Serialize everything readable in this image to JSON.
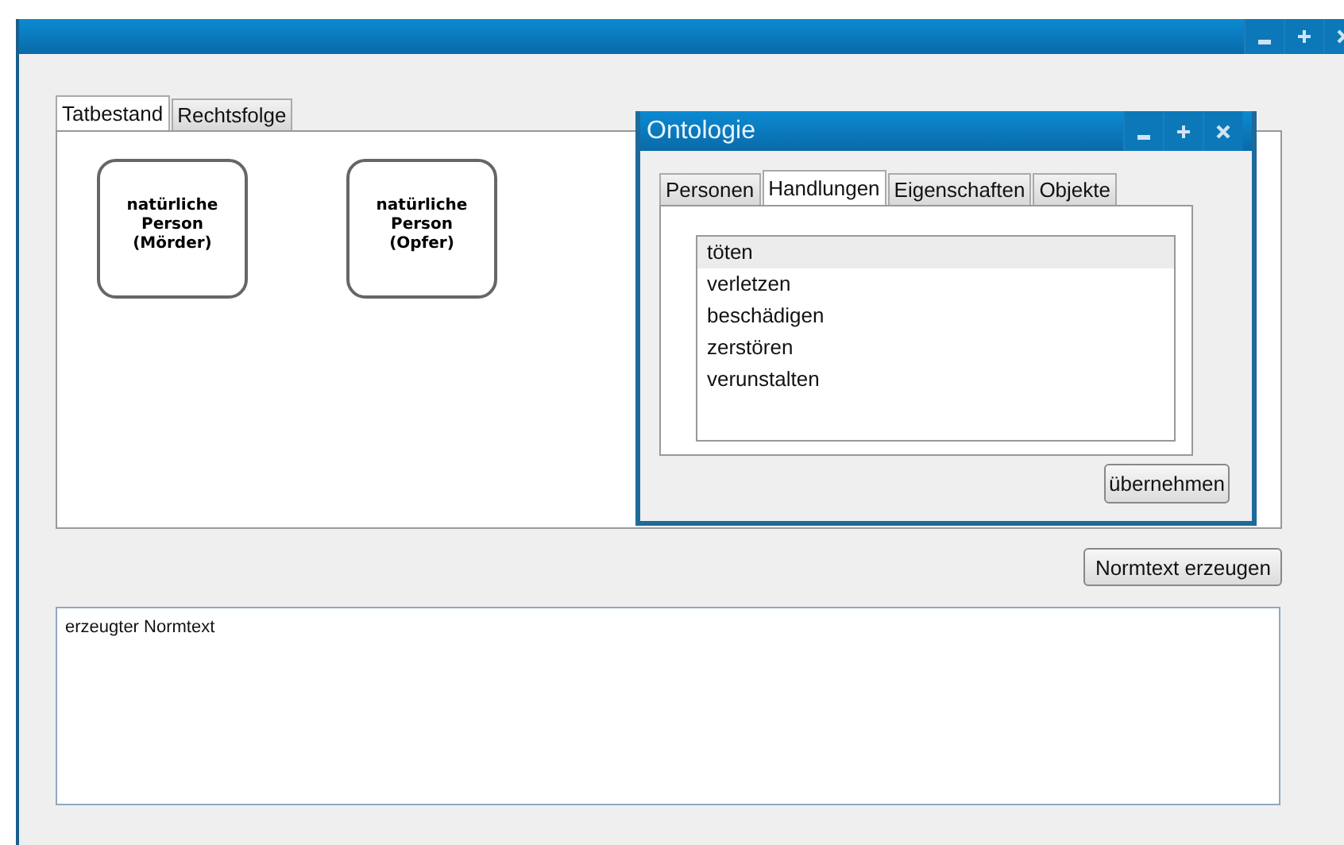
{
  "main_window": {
    "title_buttons": [
      {
        "kind": "minimize"
      },
      {
        "kind": "maximize"
      },
      {
        "kind": "close"
      }
    ]
  },
  "tabs": [
    {
      "label": "Tatbestand",
      "selected": true
    },
    {
      "label": "Rechtsfolge",
      "selected": false
    }
  ],
  "nodes": [
    {
      "label": "natürliche\nPerson\n(Mörder)"
    },
    {
      "label": "natürliche\nPerson\n(Opfer)"
    }
  ],
  "generate_button": "Normtext erzeugen",
  "output": {
    "value": "erzeugter Normtext"
  },
  "dialog": {
    "title": "Ontologie",
    "title_buttons": [
      {
        "kind": "minimize"
      },
      {
        "kind": "maximize"
      },
      {
        "kind": "close"
      }
    ],
    "tabs": [
      {
        "label": "Personen",
        "selected": false
      },
      {
        "label": "Handlungen",
        "selected": true
      },
      {
        "label": "Eigenschaften",
        "selected": false
      },
      {
        "label": "Objekte",
        "selected": false
      }
    ],
    "items": [
      {
        "label": "töten",
        "selected": true
      },
      {
        "label": "verletzen",
        "selected": false
      },
      {
        "label": "beschädigen",
        "selected": false
      },
      {
        "label": "zerstören",
        "selected": false
      },
      {
        "label": "verunstalten",
        "selected": false
      }
    ],
    "apply_button": "übernehmen"
  }
}
